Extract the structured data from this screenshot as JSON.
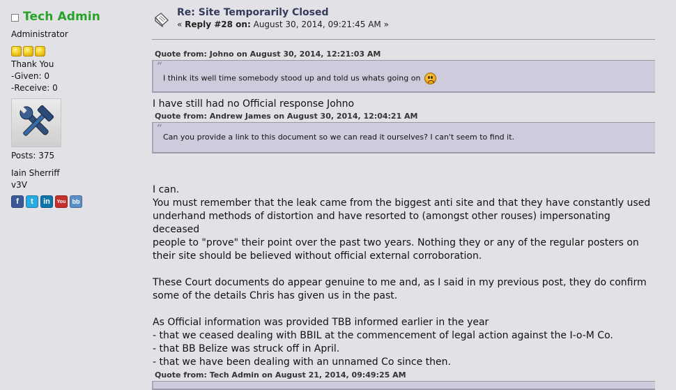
{
  "poster": {
    "name": "Tech Admin",
    "rank": "Administrator",
    "thank_you": "Thank You",
    "given": "-Given: 0",
    "received": "-Receive: 0",
    "posts": "Posts: 375",
    "real_name": "Iain Sherriff",
    "signature": "v3V",
    "social_icons": [
      "facebook-icon",
      "twitter-icon",
      "linkedin-icon",
      "youtube-icon",
      "blogger-icon"
    ],
    "stars": 3
  },
  "post": {
    "subject": "Re: Site Temporarily Closed",
    "reply_prefix": "«",
    "reply_label": "Reply #28 on:",
    "reply_date": "August 30, 2014, 09:21:45 AM",
    "reply_suffix": "»"
  },
  "quotes": [
    {
      "header": "Quote from: Johno on August 30, 2014, 12:21:03 AM",
      "text": "I think its well time somebody stood up and told us whats going on"
    },
    {
      "header": "Quote from: Andrew James on August 30, 2014, 12:04:21 AM",
      "text": "Can you provide a link to this document so we can read it ourselves? I can't seem to find it."
    },
    {
      "header": "Quote from: Tech Admin on August 21, 2014, 09:49:25 AM"
    }
  ],
  "reply_to_johno": "I have still had no Official response Johno",
  "body": {
    "line1": "I can.",
    "para1": [
      "You must remember that the leak came from the biggest anti site and that they have constantly used",
      "underhand methods of distortion and have resorted to (amongst other rouses) impersonating deceased",
      "people to \"prove\" their point over the past two years. Nothing they or any of the regular posters on",
      "their site should be believed without official external corroboration."
    ],
    "para2": [
      "These Court documents do appear genuine to me and, as I said in my previous post, they do confirm",
      "some of the details Chris has given us in the past."
    ],
    "para3": [
      "As Official information was provided TBB informed earlier in the year",
      "- that we ceased dealing with BBIL at the commencement of legal action against the I-o-M Co.",
      "- that BB Belize was struck off in April.",
      "- that we have been dealing with an unnamed  Co since then."
    ]
  },
  "colors": {
    "background": "#e2e1e6",
    "poster_name": "#27a327",
    "quote_bg": "#cfcbdd",
    "subject": "#333a5c"
  }
}
